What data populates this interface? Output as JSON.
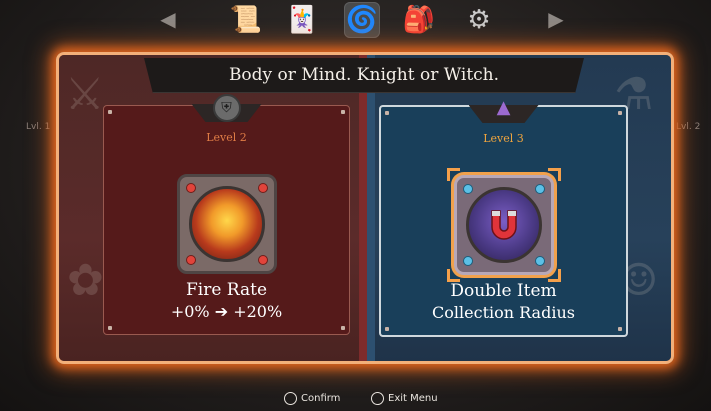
{
  "nav": {
    "tabs": [
      {
        "name": "scroll-map-icon",
        "selected": false
      },
      {
        "name": "cards-icon",
        "selected": false
      },
      {
        "name": "swirl-icon",
        "selected": true
      },
      {
        "name": "backpack-icon",
        "selected": false
      },
      {
        "name": "gear-icon",
        "selected": false
      }
    ]
  },
  "title": "Body or Mind. Knight or Witch.",
  "side_levels": {
    "left": "Lvl. 1",
    "right": "Lvl. 2"
  },
  "choices": [
    {
      "side": "left",
      "emblem": "knight-helmet-icon",
      "level": "Level 2",
      "name": "Fire Rate",
      "change": "+0% ➔ +20%",
      "icon": "fire-orb-icon"
    },
    {
      "side": "right",
      "emblem": "witch-hat-icon",
      "level": "Level 3",
      "name_line1": "Double Item",
      "name_line2": "Collection Radius",
      "icon": "magnet-icon",
      "selected": true
    }
  ],
  "footer": {
    "confirm": "Confirm",
    "exit": "Exit Menu"
  }
}
